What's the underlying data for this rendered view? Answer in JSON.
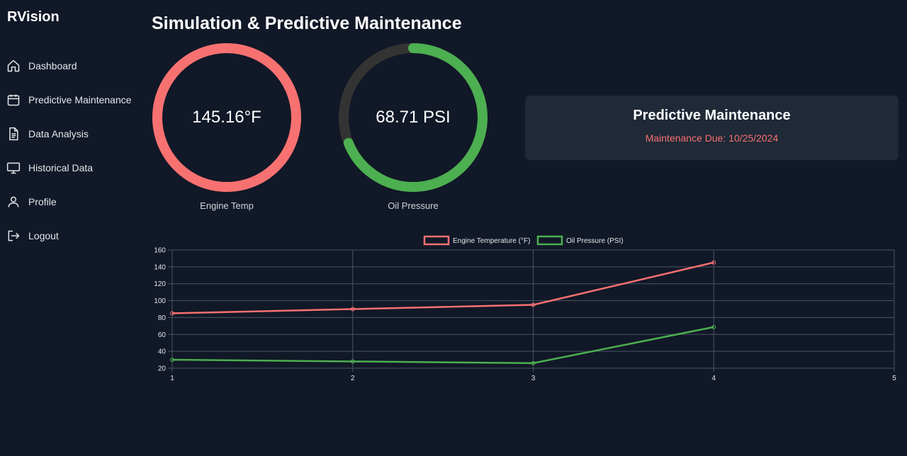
{
  "brand": "RVision",
  "page_title": "Simulation & Predictive Maintenance",
  "sidebar": {
    "items": [
      {
        "label": "Dashboard",
        "icon": "home-icon"
      },
      {
        "label": "Predictive Maintenance",
        "icon": "calendar-icon"
      },
      {
        "label": "Data Analysis",
        "icon": "document-icon"
      },
      {
        "label": "Historical Data",
        "icon": "monitor-icon"
      },
      {
        "label": "Profile",
        "icon": "user-icon"
      },
      {
        "label": "Logout",
        "icon": "logout-icon"
      }
    ]
  },
  "gauges": {
    "engine": {
      "value_text": "145.16°F",
      "label": "Engine Temp",
      "fill_fraction": 1.0,
      "color": "#f87171"
    },
    "oil": {
      "value_text": "68.71 PSI",
      "label": "Oil Pressure",
      "fill_fraction": 0.69,
      "color": "#4caf50"
    }
  },
  "maintenance_card": {
    "title": "Predictive Maintenance",
    "due_text": "Maintenance Due: 10/25/2024"
  },
  "colors": {
    "background": "#111827",
    "card": "#1f2937",
    "engine": "#f87171",
    "oil": "#4caf50",
    "gauge_track": "#333333"
  },
  "chart_data": {
    "type": "line",
    "x": [
      1,
      2,
      3,
      4
    ],
    "xticks": [
      1,
      2,
      3,
      4,
      5
    ],
    "xlim": [
      1,
      5
    ],
    "ylim": [
      20,
      160
    ],
    "yticks": [
      20,
      40,
      60,
      80,
      100,
      120,
      140,
      160
    ],
    "grid": true,
    "legend": "top-center",
    "series": [
      {
        "name": "Engine Temperature (°F)",
        "values": [
          85,
          90,
          95,
          145.16
        ],
        "color": "#f87171"
      },
      {
        "name": "Oil Pressure (PSI)",
        "values": [
          30,
          28,
          26,
          68.71
        ],
        "color": "#4caf50"
      }
    ]
  }
}
